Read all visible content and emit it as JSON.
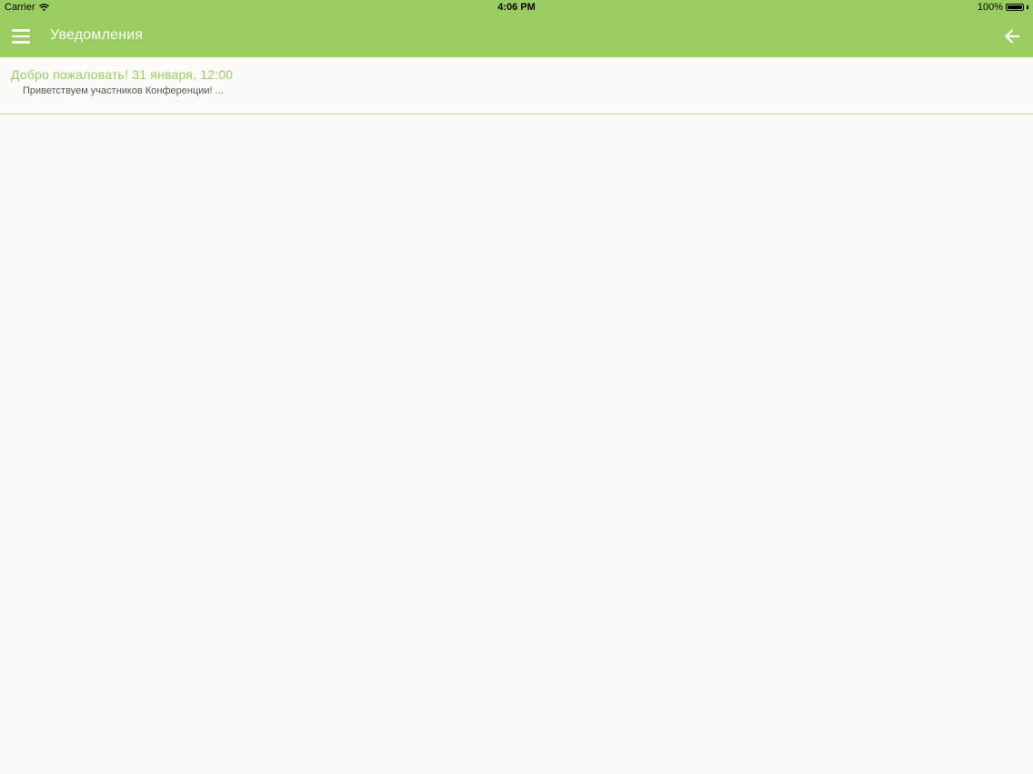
{
  "status_bar": {
    "carrier": "Carrier",
    "time": "4:06 PM",
    "battery": "100%"
  },
  "nav": {
    "title": "Уведомления",
    "menu_icon": "hamburger-menu-icon",
    "back_icon": "arrow-left-icon"
  },
  "notifications": [
    {
      "title": "Добро пожаловать! 31 января, 12:00",
      "preview": "Приветствуем участников Конференции! ..."
    }
  ],
  "colors": {
    "accent": "#9acd5f",
    "background": "#f9f9f7"
  }
}
